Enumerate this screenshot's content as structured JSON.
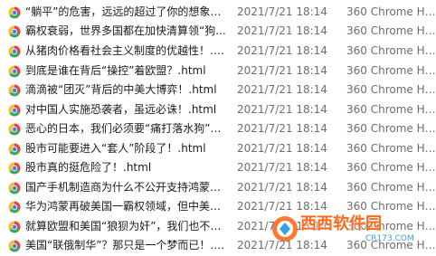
{
  "files": [
    {
      "name": "“躺平”的危害，远远的超过了你的想象！.html",
      "date": "2021/7/21 18:14",
      "type": "360 Chrome HTML"
    },
    {
      "name": "霸权衰弱，世界多国都在加快清算领“狗...",
      "date": "2021/7/21 18:14",
      "type": "360 Chrome HTML"
    },
    {
      "name": "从猪肉价格看社会主义制度的优越性！.html",
      "date": "2021/7/21 18:14",
      "type": "360 Chrome HTML"
    },
    {
      "name": "到底是谁在背后“操控”着欧盟？.html",
      "date": "2021/7/21 18:14",
      "type": "360 Chrome HTML"
    },
    {
      "name": "滴滴被“团灭”背后的中美大博弈！.html",
      "date": "2021/7/21 18:14",
      "type": "360 Chrome HTML"
    },
    {
      "name": "对中国人实施恐袭者，虽远必诛！.html",
      "date": "2021/7/21 18:14",
      "type": "360 Chrome HTML"
    },
    {
      "name": "恶心的日本，我们必须要“痛打落水狗”！.html",
      "date": "2021/7/21 18:14",
      "type": "360 Chrome HTML"
    },
    {
      "name": "股市可能要进入“套人”阶段了！.html",
      "date": "2021/7/21 18:14",
      "type": "360 Chrome HTML"
    },
    {
      "name": "股市真的挺危险了！.html",
      "date": "2021/7/21 18:14",
      "type": "360 Chrome HTML"
    },
    {
      "name": "国产手机制造商为什么不公开支持鸿蒙?.html",
      "date": "2021/7/21 18:14",
      "type": "360 Chrome HTML"
    },
    {
      "name": "华为鸿蒙再破美国一霸权领域，但中美技...",
      "date": "2021/7/21 18:14",
      "type": "360 Chrome HTML"
    },
    {
      "name": "就算欧盟和美国“狼狈为奸”，我们也不怕...",
      "date": "2021/7/21 18:14",
      "type": "360 Chrome HTML"
    },
    {
      "name": "美国“联俄制华”？那只是一个梦而已！.html",
      "date": "2021/7/21 18:14",
      "type": "360 Chrome HTML"
    }
  ],
  "watermark": {
    "main_text": "西西软件园",
    "sub_text": "CR173.COM"
  },
  "colors": {
    "icon_red": "#e8453c",
    "icon_yellow": "#f9bb2d",
    "icon_green": "#3aa757",
    "icon_blue": "#4285f4",
    "watermark_orange": "#ff6a1a",
    "watermark_blue": "#3e9fe0"
  }
}
